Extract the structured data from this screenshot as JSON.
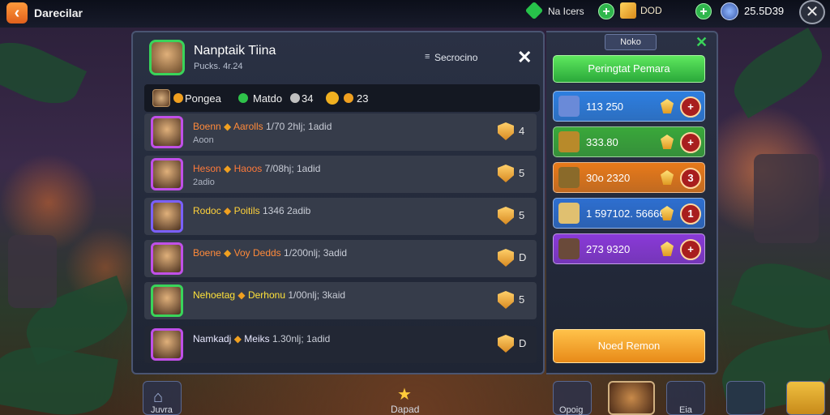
{
  "topbar": {
    "title": "Darecilar",
    "resource_label": "Na Icers",
    "gold_value": "DOD",
    "score_value": "25.5D39"
  },
  "panel": {
    "title": "Nanptaik Tiina",
    "subtitle": "Pucks. 4r.24",
    "sort_icon": "≡",
    "sort_label": "Secrocino",
    "close": "✕",
    "header": {
      "name": "Pongea",
      "mode": "Matdo",
      "coin_value": "34",
      "shield_value": "23"
    },
    "rows": [
      {
        "name": "Boenn",
        "tags": "Aarolls",
        "stats": "1/70 2hlj; 1adid",
        "sub": "Aoon",
        "rank": "4",
        "name_color": "#ff8a3a",
        "frame_color": "#c050e8"
      },
      {
        "name": "Heson",
        "tags": "Haoos",
        "stats": "7/08hj; 1adid",
        "sub": "2adio",
        "rank": "5",
        "name_color": "#ff7a3a",
        "frame_color": "#c050e8"
      },
      {
        "name": "Rodoc",
        "tags": "Poitils",
        "stats": "1346  2adib",
        "sub": "",
        "rank": "5",
        "name_color": "#ffd23a",
        "frame_color": "#7a60ff"
      },
      {
        "name": "Boene",
        "tags": "Voy Dedds",
        "stats": "1/200nlj; 3adid",
        "sub": "",
        "rank": "D",
        "name_color": "#ff8a3a",
        "frame_color": "#c050e8"
      },
      {
        "name": "Nehoetag",
        "tags": "Derhonu",
        "stats": "1/00nlj; 3kaid",
        "sub": "",
        "rank": "5",
        "name_color": "#ffe23a",
        "frame_color": "#39d45a"
      },
      {
        "name": "Namkadj",
        "tags": "Meiks",
        "stats": "1.30nlj; 1adid",
        "sub": "",
        "rank": "D",
        "name_color": "#e8e8ff",
        "frame_color": "#c050e8"
      }
    ]
  },
  "right_panel": {
    "tab": "Noko",
    "close": "✕",
    "primary_button": "Peringtat Pemara",
    "items": [
      {
        "value": "113 250",
        "badge": "+",
        "bg": "#2e7fe0"
      },
      {
        "value": "333.80",
        "badge": "+",
        "bg": "#3aa83a"
      },
      {
        "value": "30o 2320",
        "badge": "3",
        "bg": "#e87a1a"
      },
      {
        "value": "1 597102. 56666",
        "badge": "1",
        "bg": "#2e6fd0"
      },
      {
        "value": "273 9320",
        "badge": "+",
        "bg": "#8a3ad8"
      }
    ],
    "secondary_button": "Noed Remon"
  },
  "bottombar": {
    "home_label": "Juvra",
    "center_label": "Dapad",
    "tab3_label": "Opoig",
    "tab5_label": "Eia"
  }
}
